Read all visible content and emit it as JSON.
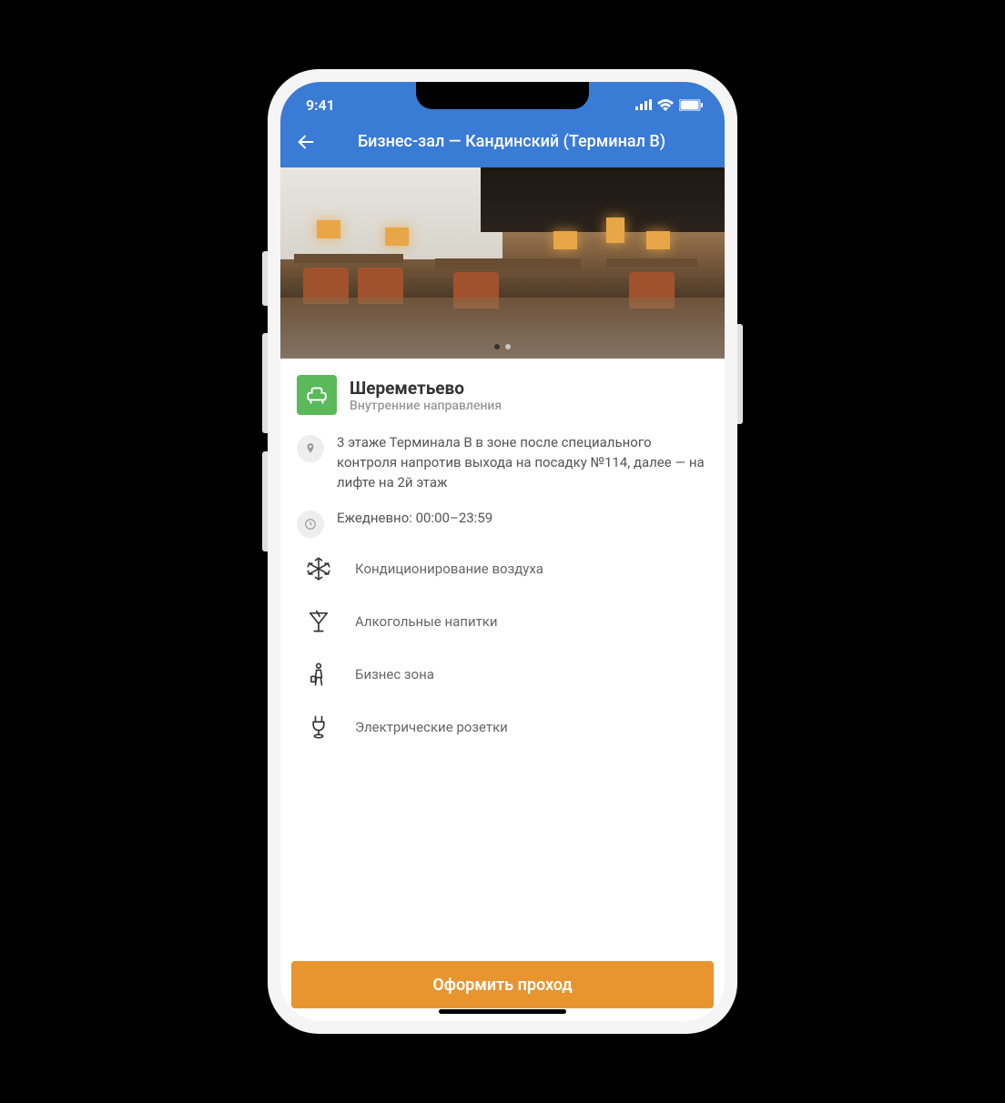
{
  "status": {
    "time": "9:41"
  },
  "header": {
    "title": "Бизнес-зал — Кандинский (Терминал B)"
  },
  "airport": {
    "name": "Шереметьево",
    "subtitle": "Внутренние направления"
  },
  "location": {
    "text": "3 этаже Терминала В в зоне после специального контроля напротив выхода на посадку №114, далее — на лифте на 2й этаж"
  },
  "hours": {
    "text": "Ежедневно: 00:00–23:59"
  },
  "amenities": [
    {
      "icon": "snowflake-icon",
      "label": "Кондиционирование воздуха"
    },
    {
      "icon": "cocktail-icon",
      "label": "Алкогольные напитки"
    },
    {
      "icon": "business-person-icon",
      "label": "Бизнес зона"
    },
    {
      "icon": "power-outlet-icon",
      "label": "Электрические розетки"
    }
  ],
  "cta": {
    "label": "Оформить проход"
  }
}
